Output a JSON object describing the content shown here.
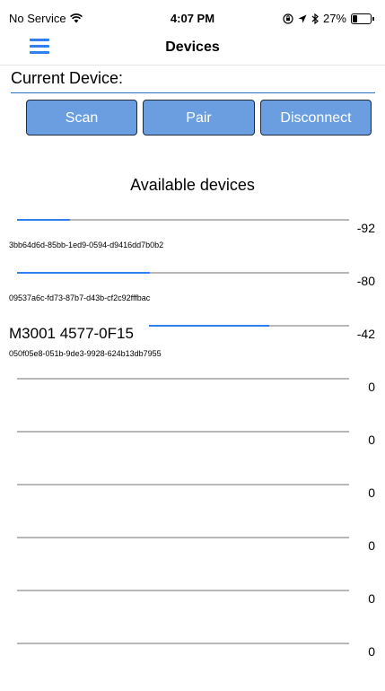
{
  "status_bar": {
    "carrier": "No Service",
    "time": "4:07 PM",
    "battery": "27%",
    "battery_level": 0.27,
    "icons": [
      "wifi-icon",
      "orientation-lock-icon",
      "location-arrow-icon",
      "bluetooth-icon",
      "battery-icon"
    ]
  },
  "nav": {
    "title": "Devices",
    "menu_icon": "hamburger-menu-icon"
  },
  "current_device": {
    "label": "Current Device:"
  },
  "actions": {
    "scan": "Scan",
    "pair": "Pair",
    "disconnect": "Disconnect"
  },
  "colors": {
    "accent": "#2f7ff0",
    "button_bg": "#6b9ee0"
  },
  "section": {
    "title": "Available devices"
  },
  "devices": [
    {
      "name": "",
      "uuid": "3bb64d6d-85bb-1ed9-0594-d9416dd7b0b2",
      "rssi": "-92",
      "signal_fraction": 0.16
    },
    {
      "name": "",
      "uuid": "09537a6c-fd73-87b7-d43b-cf2c92fffbac",
      "rssi": "-80",
      "signal_fraction": 0.4
    },
    {
      "name": "M3001 4577-0F15",
      "uuid": "050f05e8-051b-9de3-9928-624b13db7955",
      "rssi": "-42",
      "signal_fraction": 0.6
    },
    {
      "name": "",
      "uuid": "",
      "rssi": "0",
      "signal_fraction": 0
    },
    {
      "name": "",
      "uuid": "",
      "rssi": "0",
      "signal_fraction": 0
    },
    {
      "name": "",
      "uuid": "",
      "rssi": "0",
      "signal_fraction": 0
    },
    {
      "name": "",
      "uuid": "",
      "rssi": "0",
      "signal_fraction": 0
    },
    {
      "name": "",
      "uuid": "",
      "rssi": "0",
      "signal_fraction": 0
    },
    {
      "name": "",
      "uuid": "",
      "rssi": "0",
      "signal_fraction": 0
    }
  ]
}
